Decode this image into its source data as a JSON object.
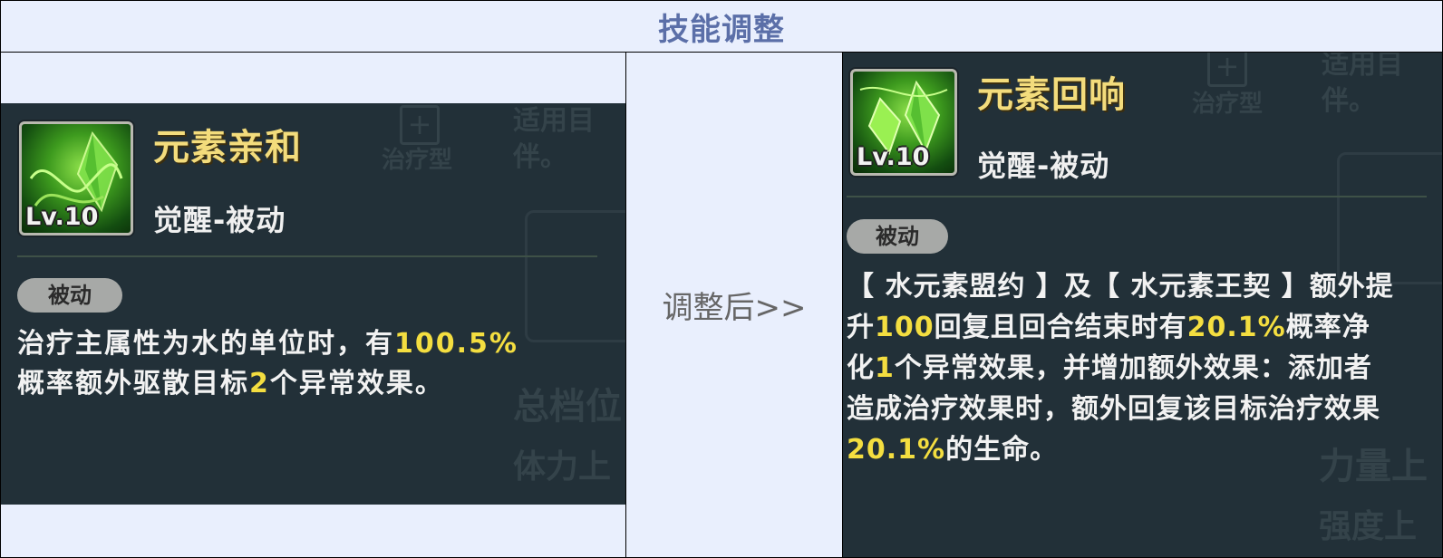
{
  "header": {
    "title": "技能调整"
  },
  "middle": {
    "label": "调整后>>"
  },
  "before": {
    "skill_name": "元素亲和",
    "skill_type": "觉醒-被动",
    "level": "Lv.10",
    "badge": "被动",
    "desc": {
      "p1": "治疗主属性为水的单位时，有",
      "v1": "100.5%",
      "p2": "概率额外驱散目标",
      "v2": "2",
      "p3": "个异常效果。"
    },
    "background": {
      "plus": "+",
      "t1": "治疗型",
      "t2": "适用目",
      "t3": "伴。",
      "t4": "总档位",
      "t5": "体力上"
    }
  },
  "after": {
    "skill_name": "元素回响",
    "skill_type": "觉醒-被动",
    "level": "Lv.10",
    "badge": "被动",
    "desc": {
      "p1": "【 水元素盟约 】及【 水元素王契 】额外提升",
      "v1": "100",
      "p2": "回复且回合结束时有",
      "v2": "20.1%",
      "p3": "概率净化",
      "v3": "1",
      "p4": "个异常效果，并增加额外效果：添加者造成治疗效果时，额外回复该目标治疗效果",
      "v4": "20.1%",
      "p5": "的生命。"
    },
    "background": {
      "plus": "+",
      "t1": "治疗型",
      "t2": "适用目",
      "t3": "伴。",
      "t4": "力量上",
      "t5": "强度上"
    }
  },
  "colors": {
    "highlight": "#f4de40",
    "title": "#5b6fa8",
    "panel": "#223038"
  }
}
